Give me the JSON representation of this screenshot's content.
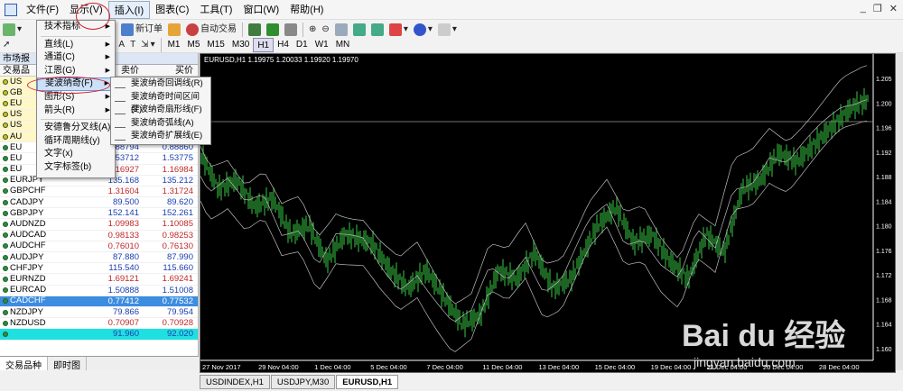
{
  "menubar": {
    "items": [
      "文件(F)",
      "显示(V)",
      "插入(I)",
      "图表(C)",
      "工具(T)",
      "窗口(W)",
      "帮助(H)"
    ]
  },
  "toolbar": {
    "new_order": "新订单",
    "auto_trade": "自动交易",
    "timeframes": [
      "M1",
      "M5",
      "M15",
      "M30",
      "H1",
      "H4",
      "D1",
      "W1",
      "MN"
    ],
    "text_a": "A",
    "text_t": "T"
  },
  "insert_menu": {
    "items": [
      {
        "label": "技术指标",
        "arrow": true
      },
      {
        "label": "直线(L)",
        "arrow": true
      },
      {
        "label": "通道(C)",
        "arrow": true
      },
      {
        "label": "江恩(G)",
        "arrow": true
      },
      {
        "label": "斐波纳奇(F)",
        "arrow": true
      },
      {
        "label": "图形(S)",
        "arrow": true
      },
      {
        "label": "箭头(R)",
        "arrow": true
      },
      {
        "label": "安德鲁分叉线(A)",
        "arrow": false
      },
      {
        "label": "循环周期线(y)",
        "arrow": false
      },
      {
        "label": "文字(x)",
        "arrow": false
      },
      {
        "label": "文字标签(b)",
        "arrow": false
      }
    ]
  },
  "fib_submenu": {
    "items": [
      "斐波纳奇回调线(R)",
      "斐波纳奇时间区间(T)",
      "斐波纳奇扇形线(F)",
      "斐波纳奇弧线(A)",
      "斐波纳奇扩展线(E)"
    ]
  },
  "market_watch": {
    "title": "市场报",
    "col_symbol": "交易品",
    "col_bid": "卖价",
    "col_ask": "买价",
    "rows": [
      {
        "symbol": "US",
        "bid": "",
        "ask": "",
        "style": "yellow"
      },
      {
        "symbol": "GB",
        "bid": "",
        "ask": "",
        "style": "yellow"
      },
      {
        "symbol": "EU",
        "bid": "",
        "ask": "",
        "style": "yellow"
      },
      {
        "symbol": "US",
        "bid": "",
        "ask": "",
        "style": "yellow"
      },
      {
        "symbol": "US",
        "bid": "",
        "ask": "",
        "style": "yellow"
      },
      {
        "symbol": "AU",
        "bid": "",
        "ask": "",
        "style": "yellow"
      },
      {
        "symbol": "EU",
        "bid": "0.88794",
        "ask": "0.88860",
        "dir": "up"
      },
      {
        "symbol": "EU",
        "bid": "1.53712",
        "ask": "1.53775",
        "dir": "up"
      },
      {
        "symbol": "EU",
        "bid": "1.16927",
        "ask": "1.16984",
        "dir": "dn"
      },
      {
        "symbol": "EURJPY",
        "bid": "135.168",
        "ask": "135.212",
        "dir": "up"
      },
      {
        "symbol": "GBPCHF",
        "bid": "1.31604",
        "ask": "1.31724",
        "dir": "dn"
      },
      {
        "symbol": "CADJPY",
        "bid": "89.500",
        "ask": "89.620",
        "dir": "up"
      },
      {
        "symbol": "GBPJPY",
        "bid": "152.141",
        "ask": "152.261",
        "dir": "up"
      },
      {
        "symbol": "AUDNZD",
        "bid": "1.09983",
        "ask": "1.10085",
        "dir": "dn"
      },
      {
        "symbol": "AUDCAD",
        "bid": "0.98133",
        "ask": "0.98253",
        "dir": "dn"
      },
      {
        "symbol": "AUDCHF",
        "bid": "0.76010",
        "ask": "0.76130",
        "dir": "dn"
      },
      {
        "symbol": "AUDJPY",
        "bid": "87.880",
        "ask": "87.990",
        "dir": "up"
      },
      {
        "symbol": "CHFJPY",
        "bid": "115.540",
        "ask": "115.660",
        "dir": "up"
      },
      {
        "symbol": "EURNZD",
        "bid": "1.69121",
        "ask": "1.69241",
        "dir": "dn"
      },
      {
        "symbol": "EURCAD",
        "bid": "1.50888",
        "ask": "1.51008",
        "dir": "up"
      },
      {
        "symbol": "CADCHF",
        "bid": "0.77412",
        "ask": "0.77532",
        "dir": "dn",
        "style": "selected"
      },
      {
        "symbol": "NZDJPY",
        "bid": "79.866",
        "ask": "79.954",
        "dir": "up"
      },
      {
        "symbol": "NZDUSD",
        "bid": "0.70907",
        "ask": "0.70928",
        "dir": "dn"
      },
      {
        "symbol": "",
        "bid": "91.960",
        "ask": "92.020",
        "dir": "up",
        "style": "cyan"
      }
    ],
    "tabs": [
      "交易品种",
      "即时图"
    ]
  },
  "chart": {
    "label": "EURUSD,H1  1.19975 1.20033 1.19920 1.19970",
    "price_ticks": [
      "1.205",
      "1.200",
      "1.196",
      "1.192",
      "1.188",
      "1.184",
      "1.180",
      "1.176",
      "1.172",
      "1.168",
      "1.164",
      "1.160"
    ],
    "date_ticks": [
      "27 Nov 2017",
      "29 Nov 04:00",
      "1 Dec 04:00",
      "5 Dec 04:00",
      "7 Dec 04:00",
      "11 Dec 04:00",
      "13 Dec 04:00",
      "15 Dec 04:00",
      "19 Dec 04:00",
      "21 Dec 04:00",
      "26 Dec 04:00",
      "28 Dec 04:00"
    ],
    "tabs": [
      "USDINDEX,H1",
      "USDJPY,M30",
      "EURUSD,H1"
    ],
    "colors": {
      "bg": "#000000",
      "candle": "#2fa83a",
      "bands": "#bbbbbb"
    }
  },
  "watermark": {
    "logo": "Bai du 经验",
    "url": "jingyan.baidu.com"
  }
}
